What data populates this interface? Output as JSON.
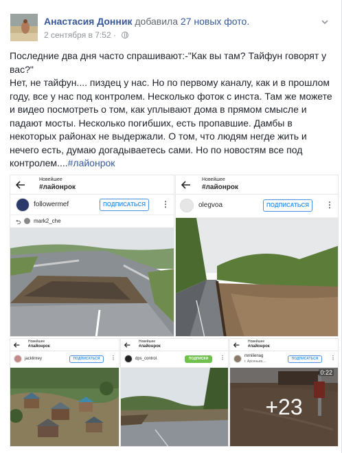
{
  "post": {
    "author": "Анастасия Донник",
    "action": "добавила",
    "photo_count_label": "27 новых фото.",
    "date": "2 сентября в 7:52",
    "separator": " · ",
    "paragraph1": "Последние два дня часто спрашивают:-\"Как вы там? Тайфун говорят у вас?\"",
    "paragraph2": "Нет, не тайфун.... пиздец у нас. Но по первому каналу, как и в прошлом году, все у нас под контролем. Несколько фоток с инста. Там же можете и видео посмотреть о том, как уплывают дома в прямом смысле и падают мосты. Несколько погибших, есть пропавшие. Дамбы в некоторых районах не выдержали. О том, что людям негде жить и нечего есть, думаю догадываетесь сами. Но по новостям все под контролем....",
    "hashtag": "#лайонрок"
  },
  "tiles": [
    {
      "subtitle": "Новейшее",
      "title": "#лайонрок",
      "user": "followermef",
      "follow": "ПОДПИСАТЬСЯ",
      "repost_user": "mark2_che",
      "dots": "⋮"
    },
    {
      "subtitle": "Новейшее",
      "title": "#лайонрок",
      "user": "olegvoa",
      "follow": "ПОДПИСАТЬСЯ",
      "dots": "⋮"
    },
    {
      "subtitle": "Новейшее",
      "title": "#лайонрок",
      "user": "jacklinrey",
      "follow": "ПОДПИСАТЬСЯ",
      "dots": "⋮"
    },
    {
      "subtitle": "Новейшее",
      "title": "#лайонрок",
      "user": "dps_control",
      "follow": "ПОДПИСКИ",
      "dots": "⋮"
    },
    {
      "subtitle": "Новейшее",
      "title": "#лайонрок",
      "user": "mmilienag",
      "user_location": "г. Арсеньев,...",
      "follow": "ПОДПИСАТЬСЯ",
      "dots": "⋮",
      "time": "0:22",
      "more": "+23"
    }
  ],
  "colors": {
    "link": "#365899",
    "meta": "#90949c",
    "follow_blue": "#3897f0",
    "follow_green": "#70c050"
  }
}
